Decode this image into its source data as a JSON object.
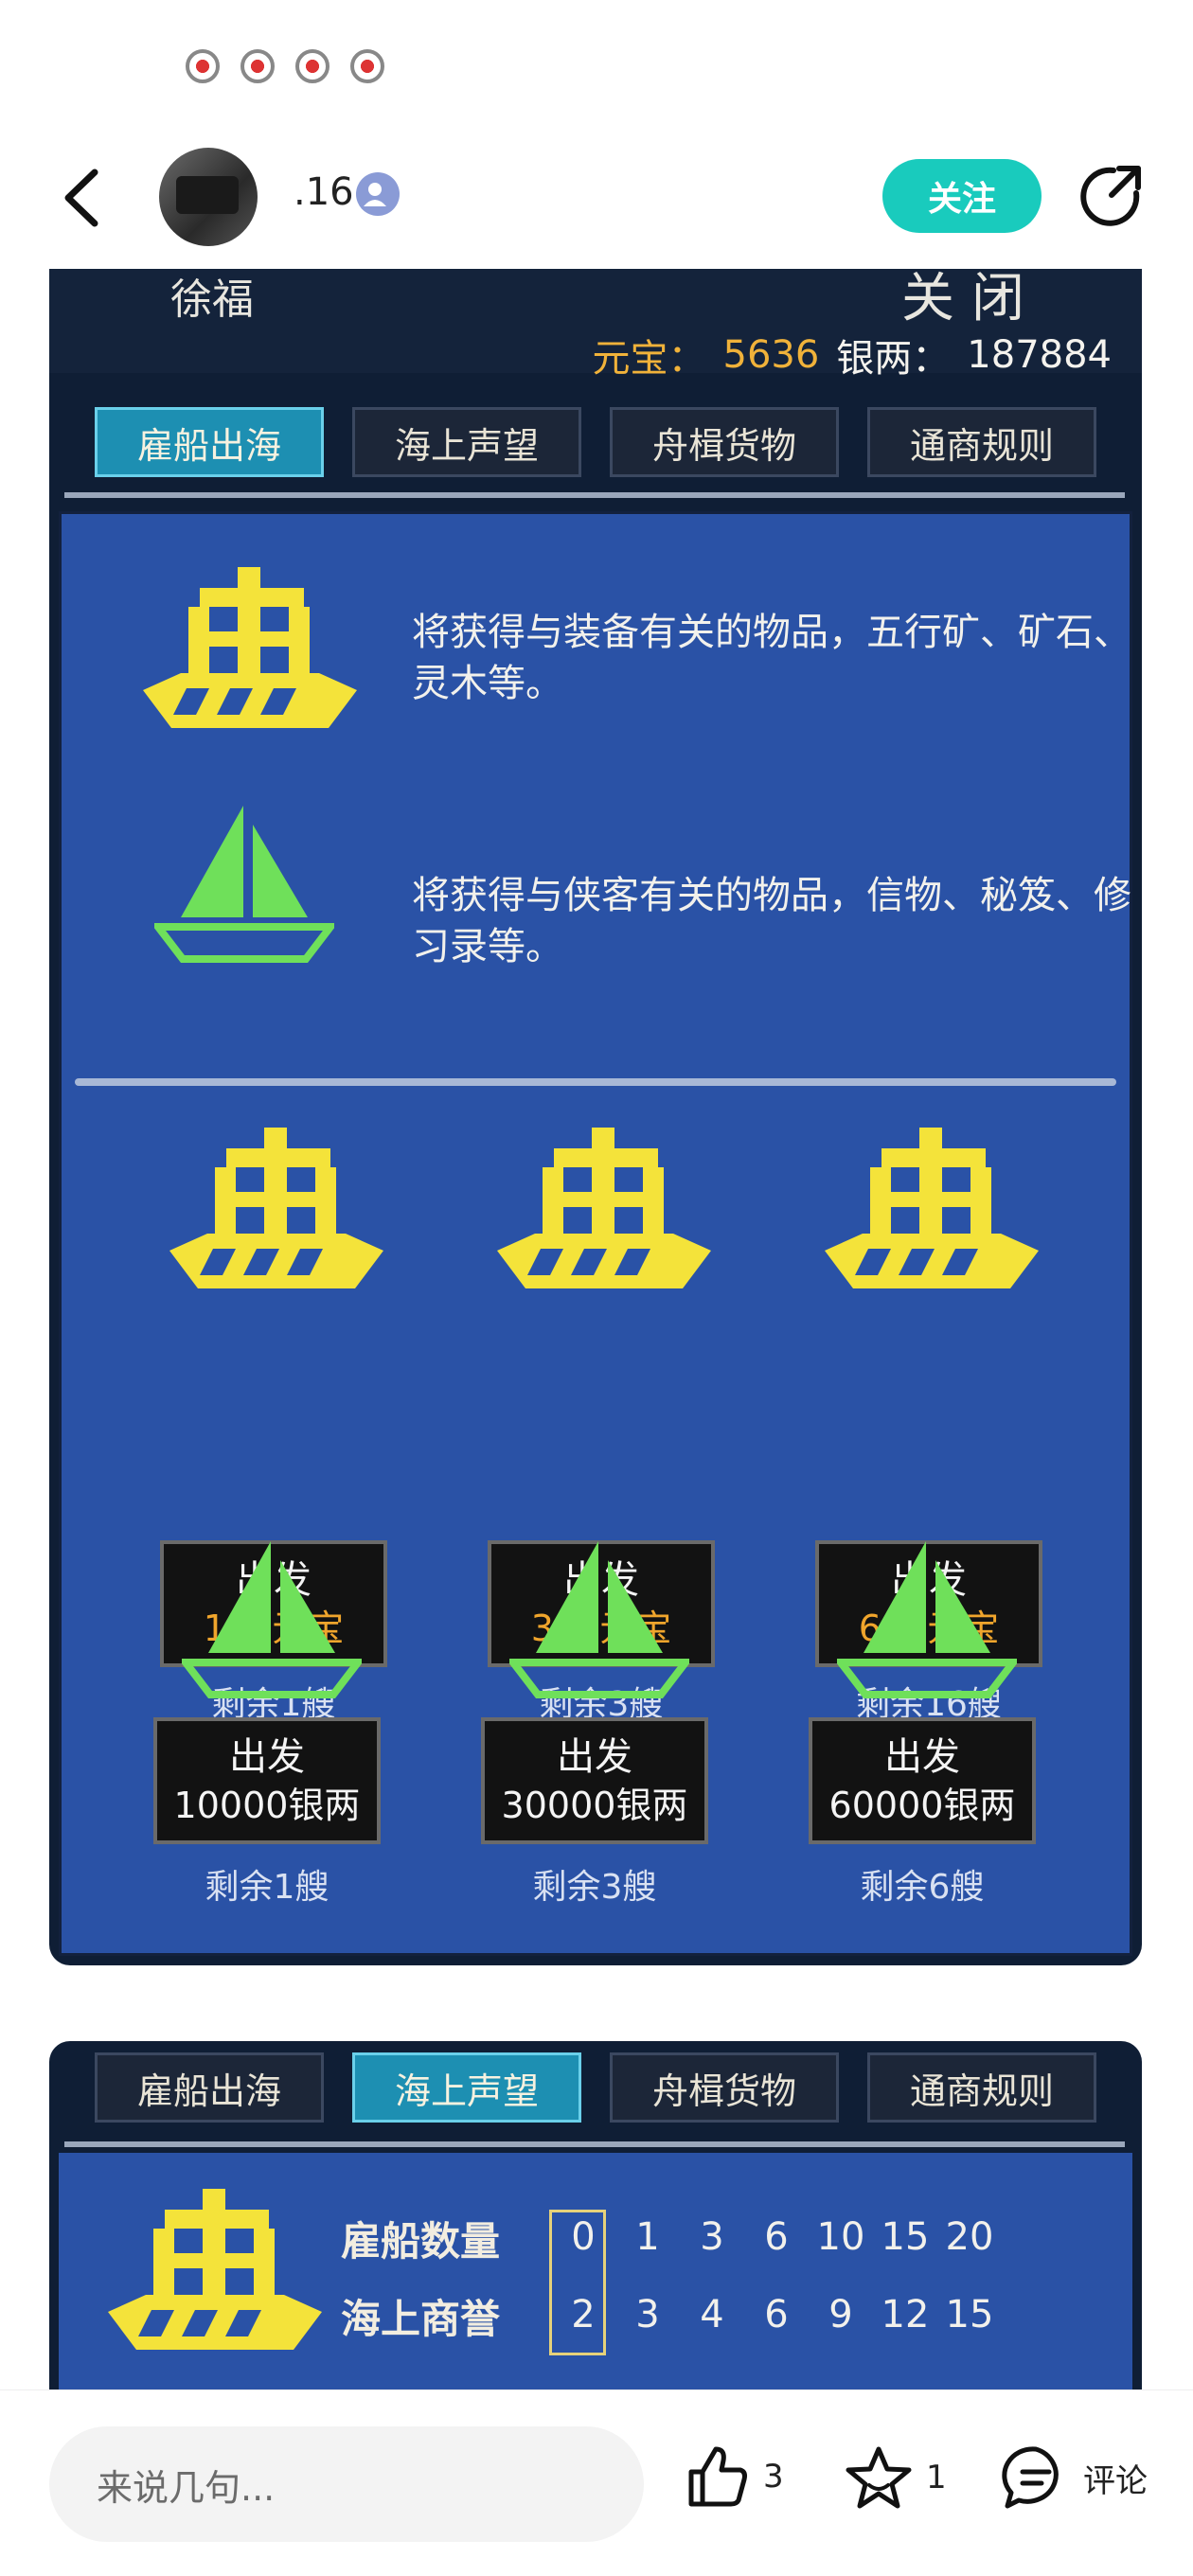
{
  "status_icons": [
    "notification-icon-1",
    "notification-icon-2",
    "notification-icon-3",
    "notification-icon-4"
  ],
  "header": {
    "username": ".16",
    "follow_label": "关注",
    "colors": {
      "follow_bg": "#19cbbd"
    }
  },
  "shot1": {
    "npc_name": "徐福",
    "close_label": "关闭",
    "currency": {
      "gold_label": "元宝：",
      "gold_value": "5636",
      "silver_label": "银两：",
      "silver_value": "187884"
    },
    "tabs": [
      {
        "label": "雇船出海",
        "active": true
      },
      {
        "label": "海上声望",
        "active": false
      },
      {
        "label": "舟楫货物",
        "active": false
      },
      {
        "label": "通商规则",
        "active": false
      }
    ],
    "descriptions": [
      {
        "icon": "junk-ship-icon",
        "text": "将获得与装备有关的物品，五行矿、矿石、灵木等。"
      },
      {
        "icon": "sailboat-icon",
        "text": "将获得与侠客有关的物品，信物、秘笈、修习录等。"
      }
    ],
    "gold_ships": [
      {
        "depart": "出发",
        "cost": "100元宝",
        "remain": "剩余1艘"
      },
      {
        "depart": "出发",
        "cost": "300元宝",
        "remain": "剩余3艘"
      },
      {
        "depart": "出发",
        "cost": "600元宝",
        "remain": "剩余16艘"
      }
    ],
    "silver_ships": [
      {
        "depart": "出发",
        "cost": "10000银两",
        "remain": "剩余1艘"
      },
      {
        "depart": "出发",
        "cost": "30000银两",
        "remain": "剩余3艘"
      },
      {
        "depart": "出发",
        "cost": "60000银两",
        "remain": "剩余6艘"
      }
    ]
  },
  "shot2": {
    "tabs": [
      {
        "label": "雇船出海",
        "active": false
      },
      {
        "label": "海上声望",
        "active": true
      },
      {
        "label": "舟楫货物",
        "active": false
      },
      {
        "label": "通商规则",
        "active": false
      }
    ],
    "rows": [
      {
        "label": "雇船数量",
        "values": [
          "0",
          "1",
          "3",
          "6",
          "10",
          "15",
          "20"
        ]
      },
      {
        "label": "海上商誉",
        "values": [
          "2",
          "3",
          "4",
          "6",
          "9",
          "12",
          "15"
        ]
      }
    ]
  },
  "bottom": {
    "comment_placeholder": "来说几句...",
    "like_count": "3",
    "favorite_count": "1",
    "comment_label": "评论"
  }
}
